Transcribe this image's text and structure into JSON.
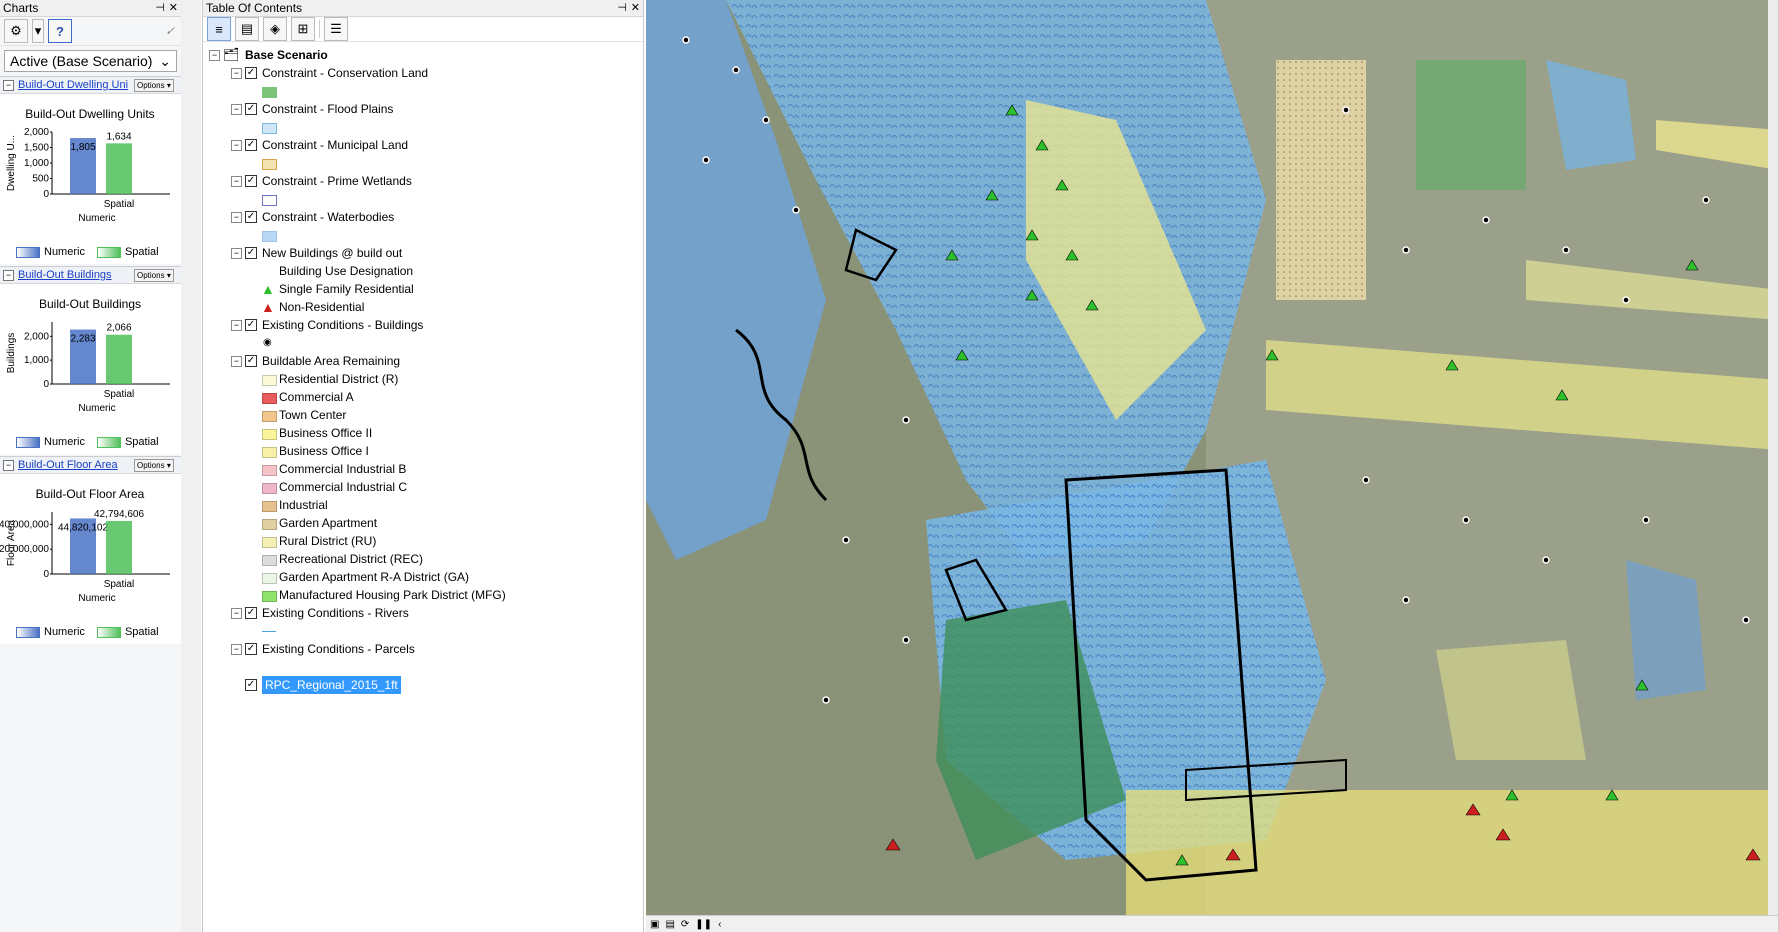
{
  "charts_pane": {
    "title": "Charts",
    "pin_icon": "pin-icon",
    "close_icon": "close-icon",
    "scenario_value": "Active (Base Scenario)",
    "charts": [
      {
        "link_label": "Build-Out Dwelling Uni",
        "options_label": "Options",
        "chart_title": "Build-Out Dwelling Units",
        "y_label": "Dwelling U...",
        "y_ticks": [
          "2,000",
          "1,500",
          "1,000",
          "500",
          "0"
        ],
        "x_labels": [
          "Numeric",
          "Spatial"
        ],
        "legend": [
          "Numeric",
          "Spatial"
        ]
      },
      {
        "link_label": "Build-Out Buildings",
        "options_label": "Options",
        "chart_title": "Build-Out Buildings",
        "y_label": "Buildings",
        "y_ticks": [
          "2,000",
          "1,000",
          "0"
        ],
        "x_labels": [
          "Numeric",
          "Spatial"
        ],
        "legend": [
          "Numeric",
          "Spatial"
        ]
      },
      {
        "link_label": "Build-Out Floor Area",
        "options_label": "Options",
        "chart_title": "Build-Out Floor Area",
        "y_label": "Floor Area",
        "y_ticks": [
          "40,000,000",
          "20,000,000",
          "0"
        ],
        "x_labels": [
          "Numeric",
          "Spatial"
        ],
        "legend": [
          "Numeric",
          "Spatial"
        ]
      }
    ]
  },
  "chart_data": [
    {
      "type": "bar",
      "title": "Build-Out Dwelling Units",
      "ylabel": "Dwelling U...",
      "categories": [
        "Numeric",
        "Spatial"
      ],
      "values": [
        1805,
        1634
      ],
      "data_labels": [
        "1,805",
        "1,634"
      ],
      "ylim": [
        0,
        2000
      ],
      "legend": [
        "Numeric",
        "Spatial"
      ],
      "colors": [
        "#4a72c4",
        "#4fbf5a"
      ]
    },
    {
      "type": "bar",
      "title": "Build-Out Buildings",
      "ylabel": "Buildings",
      "categories": [
        "Numeric",
        "Spatial"
      ],
      "values": [
        2283,
        2066
      ],
      "data_labels": [
        "2,283",
        "2,066"
      ],
      "ylim": [
        0,
        2600
      ],
      "legend": [
        "Numeric",
        "Spatial"
      ],
      "colors": [
        "#4a72c4",
        "#4fbf5a"
      ]
    },
    {
      "type": "bar",
      "title": "Build-Out Floor Area",
      "ylabel": "Floor Area",
      "categories": [
        "Numeric",
        "Spatial"
      ],
      "values": [
        44820102,
        42794606
      ],
      "data_labels": [
        "44,820,102",
        "42,794,606"
      ],
      "ylim": [
        0,
        50000000
      ],
      "legend": [
        "Numeric",
        "Spatial"
      ],
      "colors": [
        "#4a72c4",
        "#4fbf5a"
      ]
    }
  ],
  "toc": {
    "title": "Table Of Contents",
    "root_label": "Base Scenario",
    "layers": [
      {
        "label": "Constraint - Conservation Land",
        "checked": true,
        "symbol": {
          "fill": "#7cc47a",
          "stroke": "#7cc47a"
        }
      },
      {
        "label": "Constraint - Flood Plains",
        "checked": true,
        "symbol": {
          "fill": "#cfe8f7",
          "stroke": "#7fb7dc"
        }
      },
      {
        "label": "Constraint - Municipal Land",
        "checked": true,
        "symbol": {
          "fill": "#f3e3b0",
          "stroke": "#d7a54a"
        }
      },
      {
        "label": "Constraint - Prime Wetlands",
        "checked": true,
        "symbol": {
          "fill": "#ffffff",
          "stroke": "#7276c8"
        }
      },
      {
        "label": "Constraint - Waterbodies",
        "checked": true,
        "symbol": {
          "fill": "#b7d7f5",
          "stroke": "#9fc2e6"
        }
      },
      {
        "label": "New Buildings @ build out",
        "checked": true,
        "sub_heading": "Building Use Designation",
        "classes": [
          {
            "label": "Single Family Residential",
            "color": "#2cc02c",
            "icon": "green-triangle-icon"
          },
          {
            "label": "Non-Residential",
            "color": "#cc1f1f",
            "icon": "red-triangle-icon"
          }
        ]
      },
      {
        "label": "Existing Conditions - Buildings",
        "checked": true,
        "point_icon": "dot-icon"
      },
      {
        "label": "Buildable Area Remaining",
        "checked": true,
        "classes": [
          {
            "label": "Residential District (R)",
            "color": "#fbfbd8"
          },
          {
            "label": "Commercial A",
            "color": "#e85b5b"
          },
          {
            "label": "Town Center",
            "color": "#f2c58b"
          },
          {
            "label": "Business Office II",
            "color": "#faf59a"
          },
          {
            "label": "Business Office I",
            "color": "#f8f0a8"
          },
          {
            "label": "Commercial Industrial B",
            "color": "#f6c3c8"
          },
          {
            "label": "Commercial Industrial C",
            "color": "#f0b7c9"
          },
          {
            "label": "Industrial",
            "color": "#e7c28e"
          },
          {
            "label": "Garden Apartment",
            "color": "#dfcfa1"
          },
          {
            "label": "Rural District (RU)",
            "color": "#f4f0b4"
          },
          {
            "label": "Recreational District (REC)",
            "color": "#dcdcdc"
          },
          {
            "label": "Garden Apartment R-A District (GA)",
            "color": "#eaf6e4"
          },
          {
            "label": "Manufactured Housing Park District (MFG)",
            "color": "#8fe36c"
          }
        ]
      },
      {
        "label": "Existing Conditions - Rivers",
        "checked": true,
        "line_color": "#4a9fe0"
      },
      {
        "label": "Existing Conditions - Parcels",
        "checked": true
      }
    ],
    "raster_layer": {
      "label": "RPC_Regional_2015_1ft",
      "checked": true
    }
  },
  "map": {
    "status_icons": [
      "layout-view-icon",
      "data-view-icon",
      "refresh-icon",
      "pause-icon",
      "scroll-left-icon"
    ]
  }
}
